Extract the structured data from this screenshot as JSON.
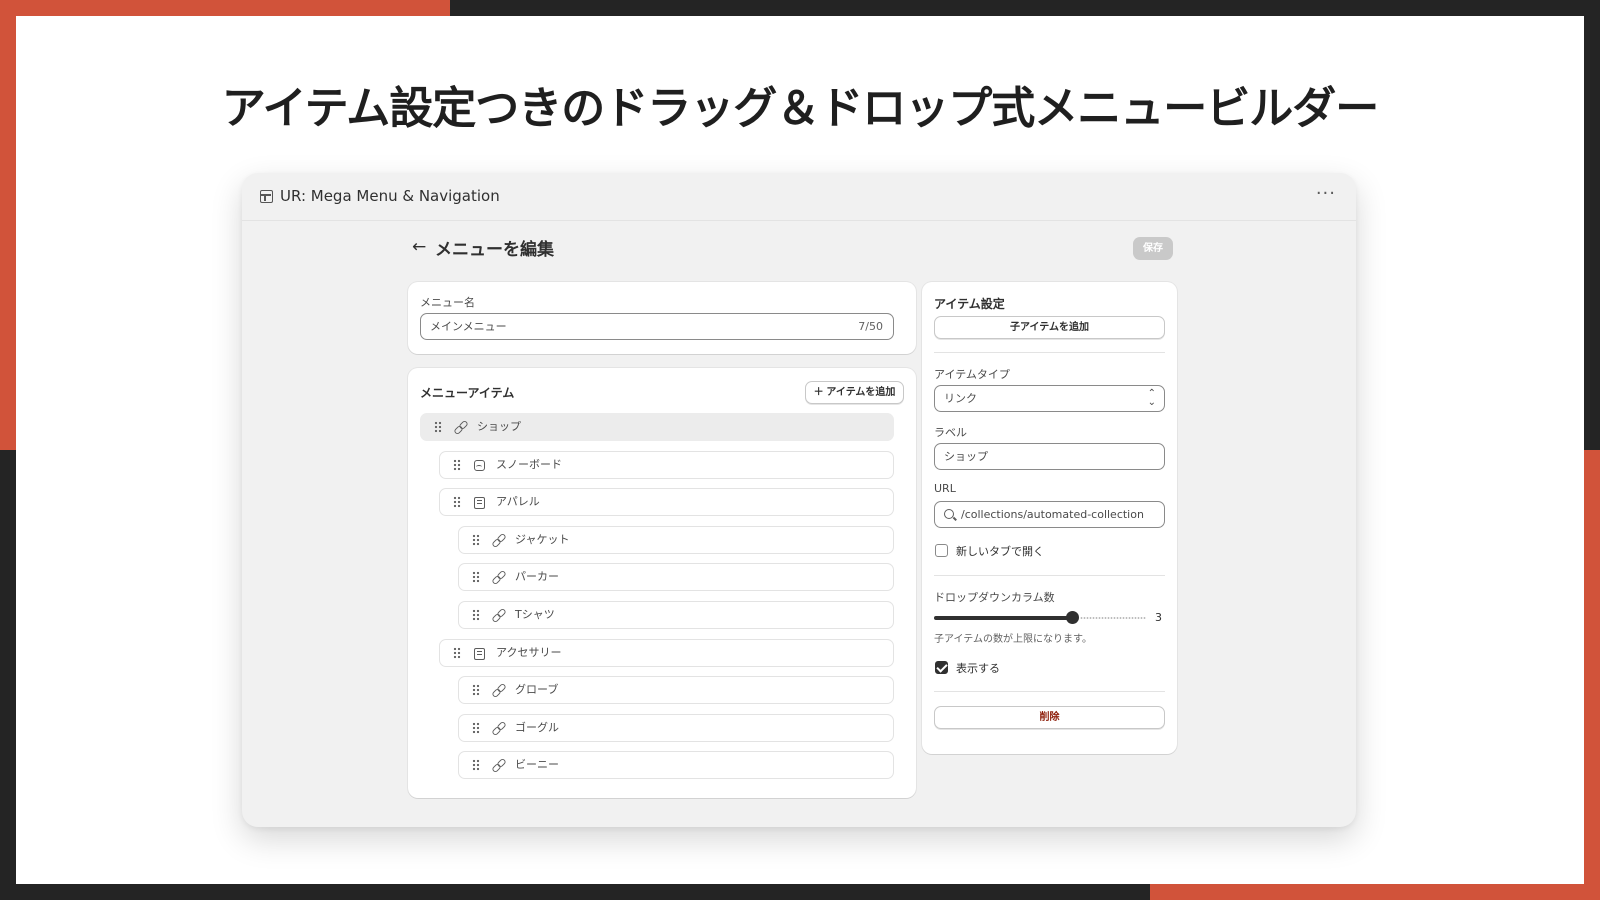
{
  "headline": "アイテム設定つきのドラッグ＆ドロップ式メニュービルダー",
  "window": {
    "title": "UR: Mega Menu & Navigation",
    "more": "···"
  },
  "page": {
    "back": "←",
    "title": "メニューを編集",
    "save_label": "保存"
  },
  "menu_name": {
    "label": "メニュー名",
    "value": "メインメニュー",
    "count": "7/50"
  },
  "menu_items": {
    "title": "メニューアイテム",
    "add_label": "＋ アイテムを追加",
    "rows": [
      {
        "label": "ショップ",
        "icon": "link-icon",
        "depth": 0,
        "selected": true
      },
      {
        "label": "スノーボード",
        "icon": "image-icon",
        "depth": 1
      },
      {
        "label": "アパレル",
        "icon": "page-icon",
        "depth": 1
      },
      {
        "label": "ジャケット",
        "icon": "link-icon",
        "depth": 2
      },
      {
        "label": "パーカー",
        "icon": "link-icon",
        "depth": 2
      },
      {
        "label": "Tシャツ",
        "icon": "link-icon",
        "depth": 2
      },
      {
        "label": "アクセサリー",
        "icon": "page-icon",
        "depth": 1
      },
      {
        "label": "グローブ",
        "icon": "link-icon",
        "depth": 2
      },
      {
        "label": "ゴーグル",
        "icon": "link-icon",
        "depth": 2
      },
      {
        "label": "ビーニー",
        "icon": "link-icon",
        "depth": 2
      }
    ]
  },
  "settings": {
    "title": "アイテム設定",
    "add_child_label": "子アイテムを追加",
    "type_label": "アイテムタイプ",
    "type_value": "リンク",
    "label_label": "ラベル",
    "label_value": "ショップ",
    "url_label": "URL",
    "url_value": "/collections/automated-collection",
    "new_tab_label": "新しいタブで開く",
    "new_tab_checked": false,
    "columns_label": "ドロップダウンカラム数",
    "columns_value": "3",
    "columns_fraction": 0.65,
    "columns_help": "子アイテムの数が上限になります。",
    "show_label": "表示する",
    "show_checked": true,
    "delete_label": "削除"
  },
  "colors": {
    "accent": "#d1533a",
    "frame": "#242424",
    "delete": "#8e1f0b"
  }
}
